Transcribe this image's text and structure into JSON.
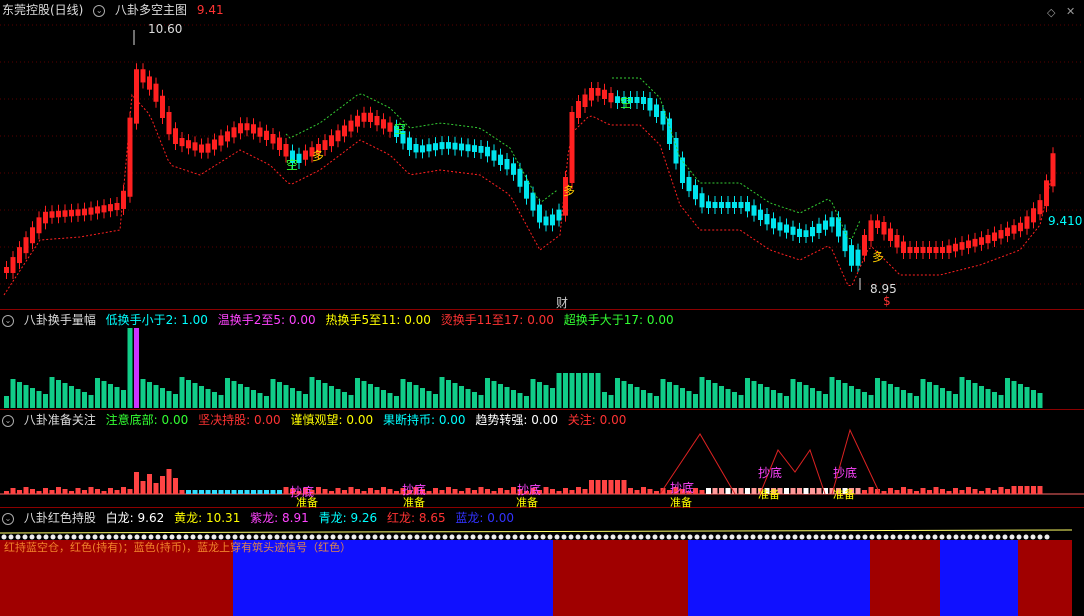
{
  "panel1": {
    "security_label": "东莞控股(日线)",
    "indicator": "八卦多空主图",
    "value": "9.41",
    "high_label": "10.60",
    "low_label": "8.95",
    "last_price_label": "9.410",
    "marker_cai": "财",
    "marker_duo": "多",
    "marker_kong": "空",
    "marker_dollar": "$"
  },
  "panel2": {
    "indicator": "八卦换手量幅",
    "items": [
      {
        "label": "低换手小于2:",
        "value": "1.00",
        "color": "#00ffff"
      },
      {
        "label": "温换手2至5:",
        "value": "0.00",
        "color": "#ff44ff"
      },
      {
        "label": "热换手5至11:",
        "value": "0.00",
        "color": "#ffff00"
      },
      {
        "label": "烫换手11至17:",
        "value": "0.00",
        "color": "#ff3333"
      },
      {
        "label": "超换手大于17:",
        "value": "0.00",
        "color": "#33ff33"
      }
    ]
  },
  "panel3": {
    "indicator": "八卦准备关注",
    "items": [
      {
        "label": "注意底部:",
        "value": "0.00",
        "color": "#33ff33"
      },
      {
        "label": "坚决持股:",
        "value": "0.00",
        "color": "#ff3333"
      },
      {
        "label": "谨慎观望:",
        "value": "0.00",
        "color": "#ffff00"
      },
      {
        "label": "果断持币:",
        "value": "0.00",
        "color": "#00ffff"
      },
      {
        "label": "趋势转强:",
        "value": "0.00",
        "color": "#ffffff"
      },
      {
        "label": "关注:",
        "value": "0.00",
        "color": "#ff3333"
      }
    ],
    "marker_chaodi": "抄底",
    "marker_zhunbei": "准备"
  },
  "panel4": {
    "indicator": "八卦红色持股",
    "items": [
      {
        "label": "白龙:",
        "value": "9.62",
        "color": "#ffffff"
      },
      {
        "label": "黄龙:",
        "value": "10.31",
        "color": "#ffff00"
      },
      {
        "label": "紫龙:",
        "value": "8.91",
        "color": "#ff44ff"
      },
      {
        "label": "青龙:",
        "value": "9.26",
        "color": "#00ffff"
      },
      {
        "label": "红龙:",
        "value": "8.65",
        "color": "#ff3333"
      },
      {
        "label": "蓝龙:",
        "value": "0.00",
        "color": "#3333ff"
      }
    ],
    "overlay_text": "红持蓝空仓，红色(持有)；蓝色(持币)，蓝龙上穿有筑头迹信号（红色）"
  },
  "colors": {
    "up": "#ff2020",
    "down": "#00e5ee",
    "border": "#8b0000",
    "support": "#ff2020",
    "resist": "#33cc33",
    "hold": "#a00000",
    "wait": "#1010ff"
  }
}
